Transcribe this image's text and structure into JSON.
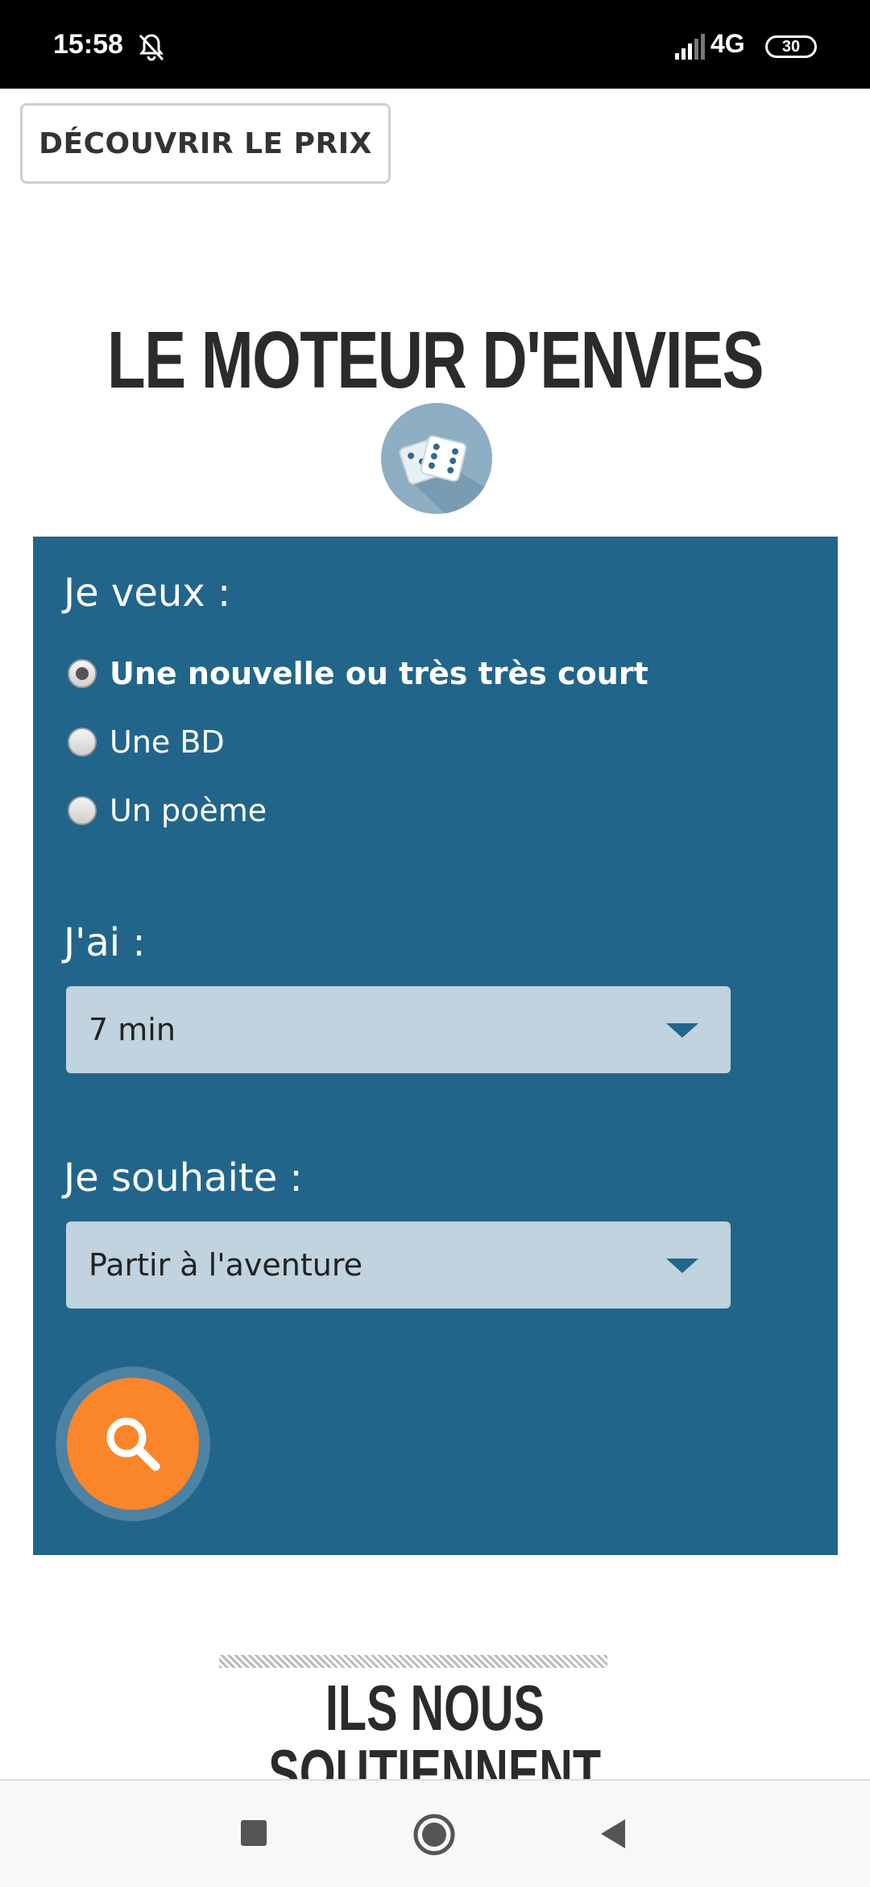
{
  "status_bar": {
    "time": "15:58",
    "network": "4G",
    "battery": "30",
    "icons": [
      "bell-muted-icon",
      "signal-icon",
      "battery-icon"
    ]
  },
  "discover_button": {
    "label": "DÉCOUVRIR LE PRIX"
  },
  "engine": {
    "title": "LE MOTEUR D'ENVIES",
    "dice_icon": "dice-icon",
    "want_label": "Je veux :",
    "options": [
      {
        "label": "Une nouvelle ou très très court",
        "checked": true
      },
      {
        "label": "Une BD",
        "checked": false
      },
      {
        "label": "Un poème",
        "checked": false
      }
    ],
    "time_label": "J'ai :",
    "time_value": "7 min",
    "wish_label": "Je souhaite :",
    "wish_value": "Partir à l'aventure",
    "search_icon": "search-icon",
    "colors": {
      "panel": "#22658b",
      "select": "#c0d3de",
      "search": "#fb852a"
    }
  },
  "supporters": {
    "title_line1": "ILS NOUS",
    "title_line2": "SOUTIENNENT"
  },
  "nav_bar": {
    "icons": [
      "square-recent-icon",
      "circle-home-icon",
      "triangle-back-icon"
    ]
  }
}
